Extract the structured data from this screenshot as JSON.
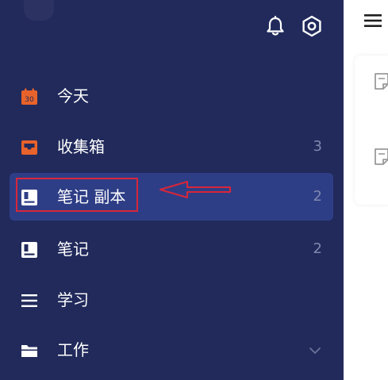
{
  "sidebar": {
    "items": [
      {
        "label": "今天",
        "icon": "calendar-icon",
        "badge": "30",
        "count": ""
      },
      {
        "label": "收集箱",
        "icon": "inbox-icon",
        "count": "3"
      },
      {
        "label": "笔记 副本",
        "icon": "notebook-icon",
        "count": "2",
        "selected": true
      },
      {
        "label": "笔记",
        "icon": "notebook-icon",
        "count": "2"
      },
      {
        "label": "学习",
        "icon": "list-icon",
        "count": ""
      },
      {
        "label": "工作",
        "icon": "folder-icon",
        "count": ""
      }
    ]
  },
  "colors": {
    "sidebar_bg": "#212a5b",
    "selected_bg": "#2e3e86",
    "accent_orange": "#e8632b",
    "annotation_red": "#d8263a",
    "count_text": "#7f87ad"
  }
}
